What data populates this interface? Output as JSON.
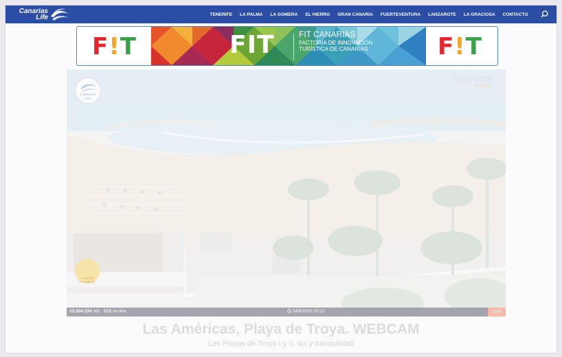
{
  "header": {
    "logo_line1": "Canarias",
    "logo_line2": "Life",
    "nav": [
      "TENERIFE",
      "LA PALMA",
      "LA GOMERA",
      "EL HIERRO",
      "GRAN CANARIA",
      "FUERTEVENTURA",
      "LANZAROTE",
      "LA GRACIOSA",
      "CONTACTO"
    ],
    "search_icon": "search-icon"
  },
  "banner": {
    "fit_left": "F!T",
    "fit_right": "F!T",
    "fit_center": "FIT",
    "title": "FIT CANARIAS",
    "subtitle": "FACTORÍA DE INNOVACIÓN TURÍSTICA DE CANARIAS"
  },
  "webcam": {
    "brand": "Skyline",
    "brand_sub": "WEBCAMS",
    "logo_text": "Canarias Life",
    "watermark_text": "CAMPUS CANARIAS",
    "stats_count": "13.304.334",
    "stats_hits_label": "hits",
    "stats_online": "512",
    "stats_online_label": "on-line",
    "stats_sep": "·",
    "timestamp": "24/6/2020 10:21",
    "live_label": "LIVE"
  },
  "page": {
    "title": "Las Américas, Playa de Troya. WEBCAM",
    "subtitle": "Las Playas de Troya I y II, sol y tranquilidad"
  },
  "colors": {
    "header_bg": "#2c4da4",
    "live_badge": "#f6b8a8"
  }
}
